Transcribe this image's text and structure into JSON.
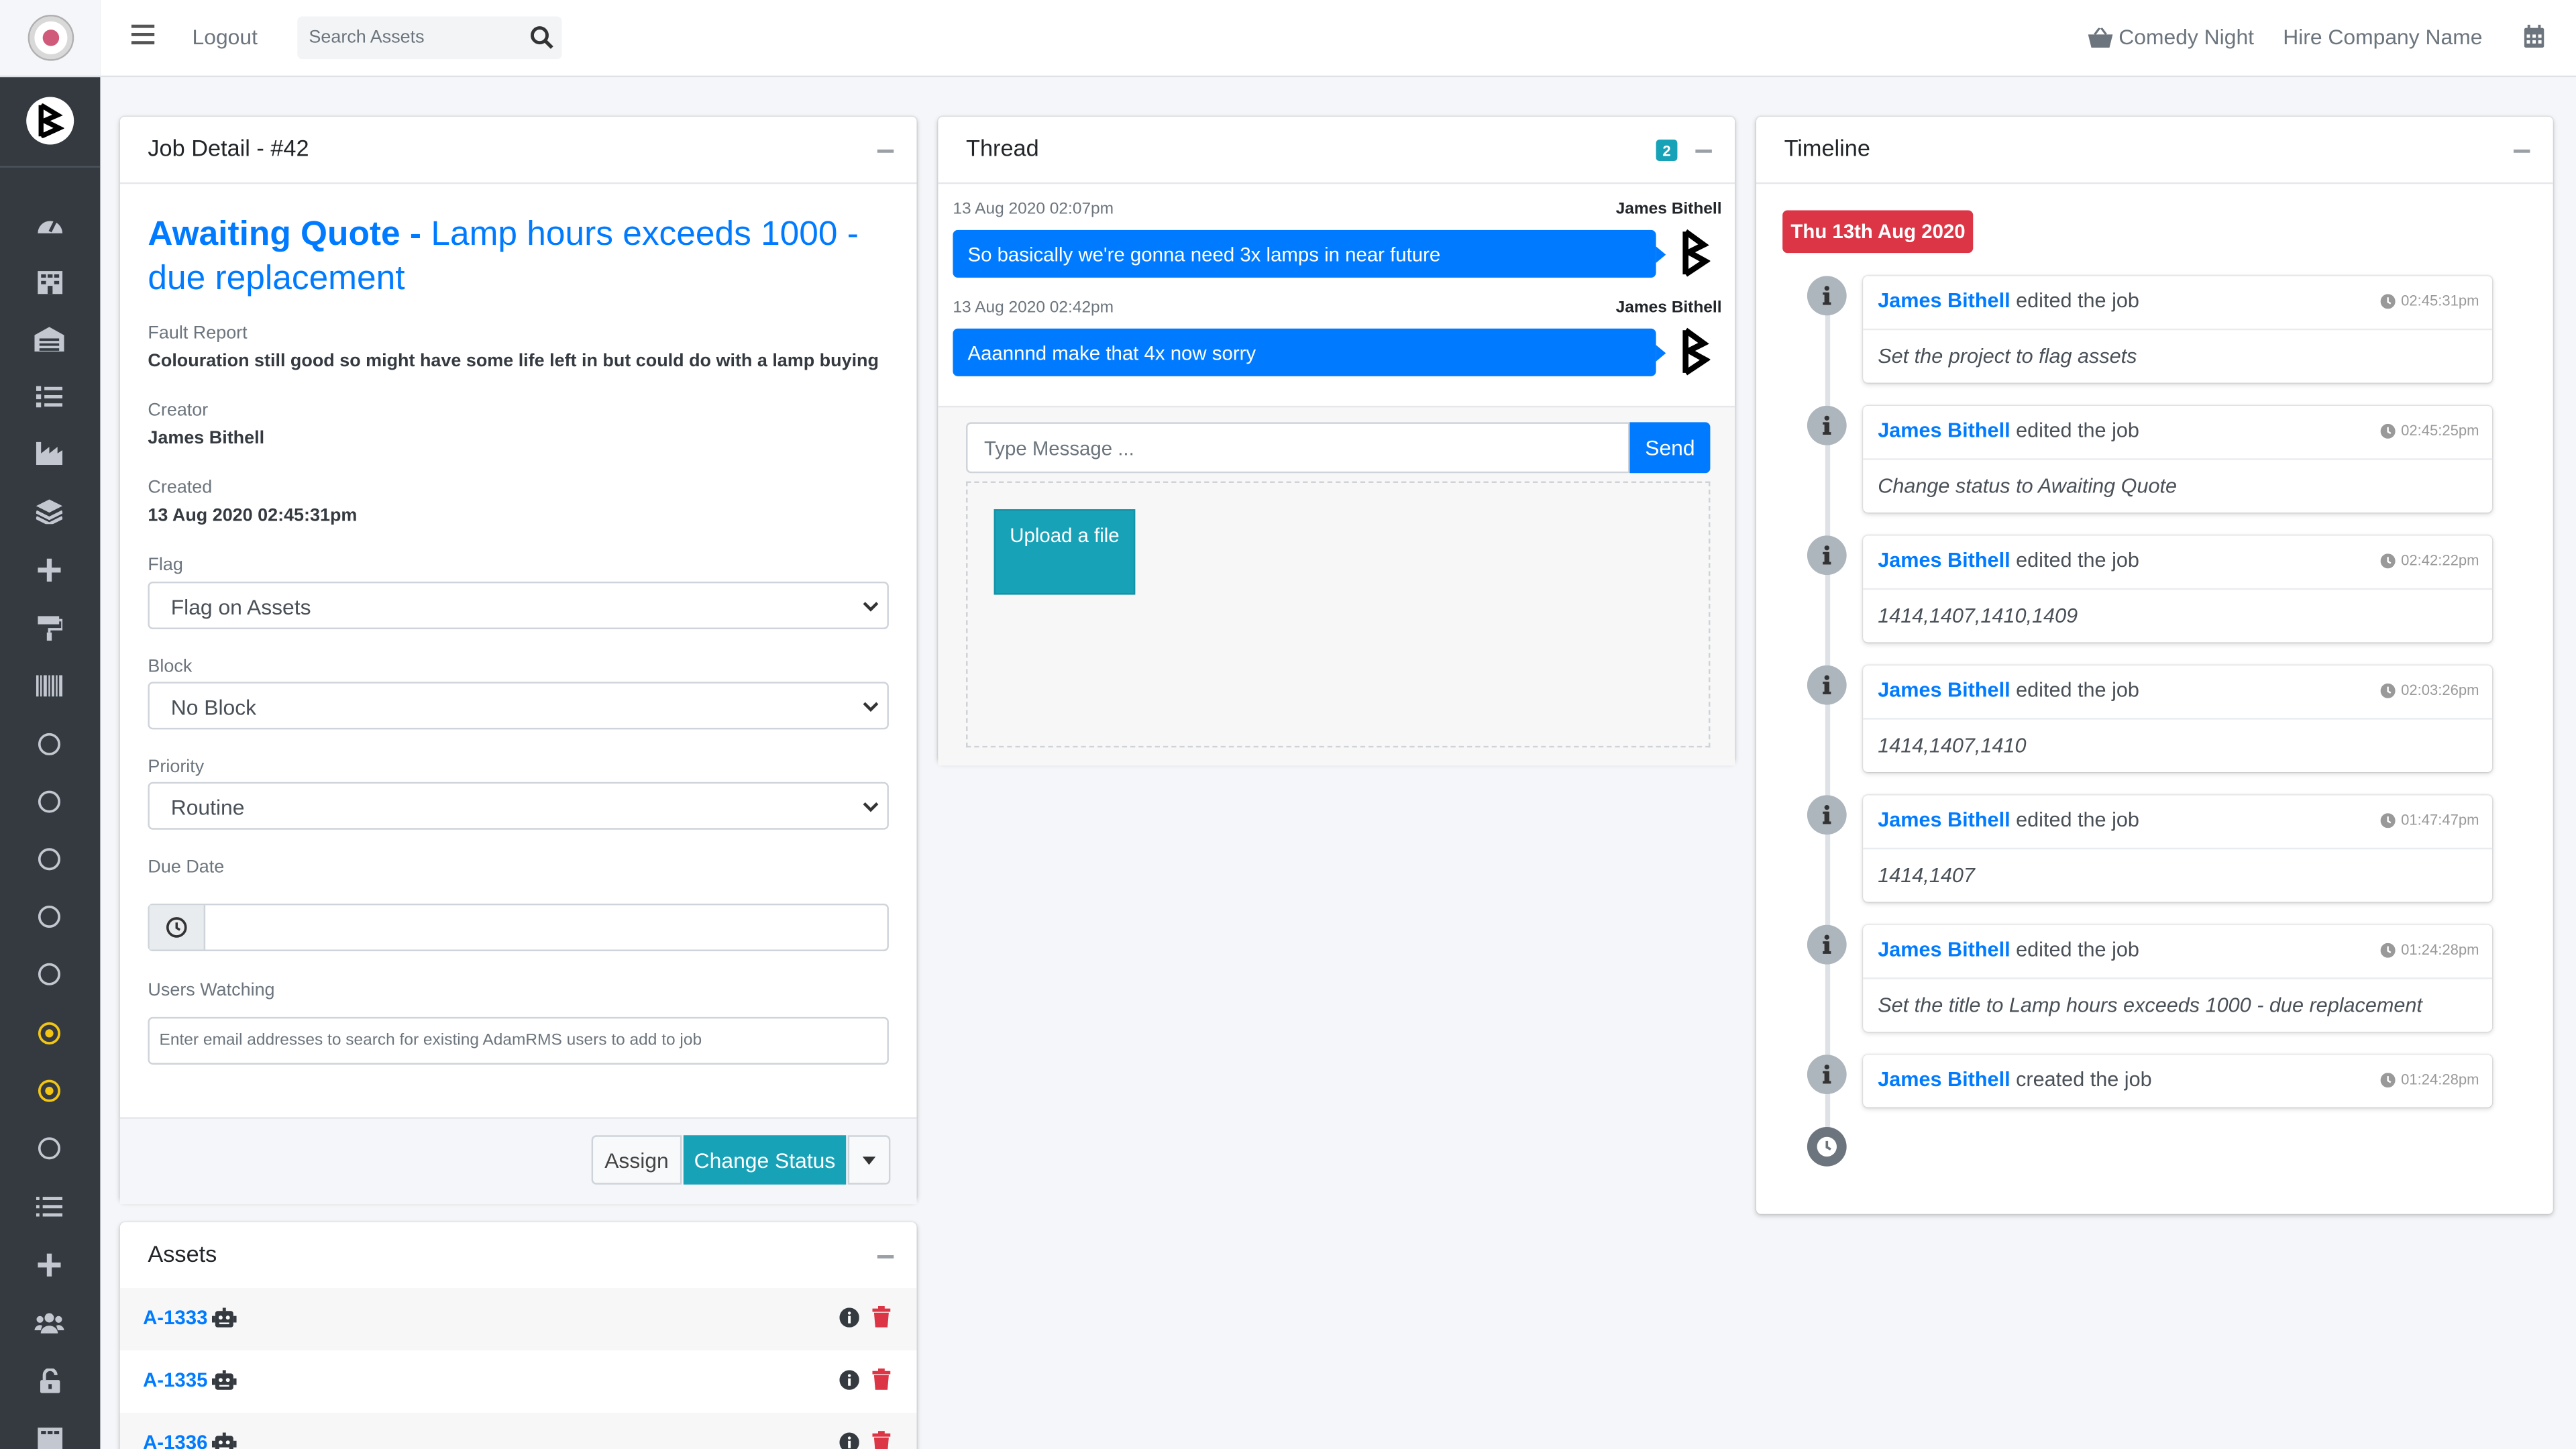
{
  "topbar": {
    "logout_label": "Logout",
    "search_placeholder": "Search Assets",
    "project_name": "Comedy Night",
    "company_name": "Hire Company Name"
  },
  "sidebar": {
    "items": [
      "tachometer-icon",
      "building-icon",
      "warehouse-icon",
      "list-icon",
      "industry-icon",
      "layers-icon",
      "plus-icon",
      "paint-roller-icon",
      "barcode-icon",
      "circle-icon",
      "circle-icon",
      "circle-icon",
      "circle-icon",
      "circle-icon",
      "dot-circle-icon",
      "dot-circle-icon",
      "circle-icon",
      "list-ol-icon",
      "plus-icon",
      "users-icon",
      "unlock-icon",
      "building-icon"
    ]
  },
  "job": {
    "title": "Job Detail - #42",
    "status": "Awaiting Quote -",
    "name": "Lamp hours exceeds 1000 - due replacement",
    "fault_label": "Fault Report",
    "fault_value": "Colouration still good so might have some life left in but could do with a lamp buying",
    "creator_label": "Creator",
    "creator_value": "James Bithell",
    "created_label": "Created",
    "created_value": "13 Aug 2020 02:45:31pm",
    "flag_label": "Flag",
    "flag_value": "Flag on Assets",
    "block_label": "Block",
    "block_value": "No Block",
    "priority_label": "Priority",
    "priority_value": "Routine",
    "due_label": "Due Date",
    "due_value": "",
    "watching_label": "Users Watching",
    "watching_placeholder": "Enter email addresses to search for existing AdamRMS users to add to job",
    "assign_label": "Assign",
    "change_status_label": "Change Status"
  },
  "assets": {
    "title": "Assets",
    "items": [
      {
        "tag": "A-1333"
      },
      {
        "tag": "A-1335"
      },
      {
        "tag": "A-1336"
      }
    ]
  },
  "thread": {
    "title": "Thread",
    "count": "2",
    "messages": [
      {
        "time": "13 Aug 2020 02:07pm",
        "author": "James Bithell",
        "text": "So basically we're gonna need 3x lamps in near future"
      },
      {
        "time": "13 Aug 2020 02:42pm",
        "author": "James Bithell",
        "text": "Aaannnd make that 4x now sorry"
      }
    ],
    "input_placeholder": "Type Message ...",
    "send_label": "Send",
    "upload_label": "Upload a file"
  },
  "timeline": {
    "title": "Timeline",
    "date_label": "Thu 13th Aug 2020",
    "events": [
      {
        "user": "James Bithell",
        "action": "edited the job",
        "time": "02:45:31pm",
        "detail": "Set the project to flag assets"
      },
      {
        "user": "James Bithell",
        "action": "edited the job",
        "time": "02:45:25pm",
        "detail": "Change status to Awaiting Quote"
      },
      {
        "user": "James Bithell",
        "action": "edited the job",
        "time": "02:42:22pm",
        "detail": "1414,1407,1410,1409"
      },
      {
        "user": "James Bithell",
        "action": "edited the job",
        "time": "02:03:26pm",
        "detail": "1414,1407,1410"
      },
      {
        "user": "James Bithell",
        "action": "edited the job",
        "time": "01:47:47pm",
        "detail": "1414,1407"
      },
      {
        "user": "James Bithell",
        "action": "edited the job",
        "time": "01:24:28pm",
        "detail": "Set the title to Lamp hours exceeds 1000 - due replacement"
      },
      {
        "user": "James Bithell",
        "action": "created the job",
        "time": "01:24:28pm",
        "detail": ""
      }
    ]
  },
  "colors": {
    "primary": "#007bff",
    "info": "#17a2b8",
    "danger": "#dc3545",
    "sidebar": "#343a40",
    "active_nav": "#f3c614"
  }
}
